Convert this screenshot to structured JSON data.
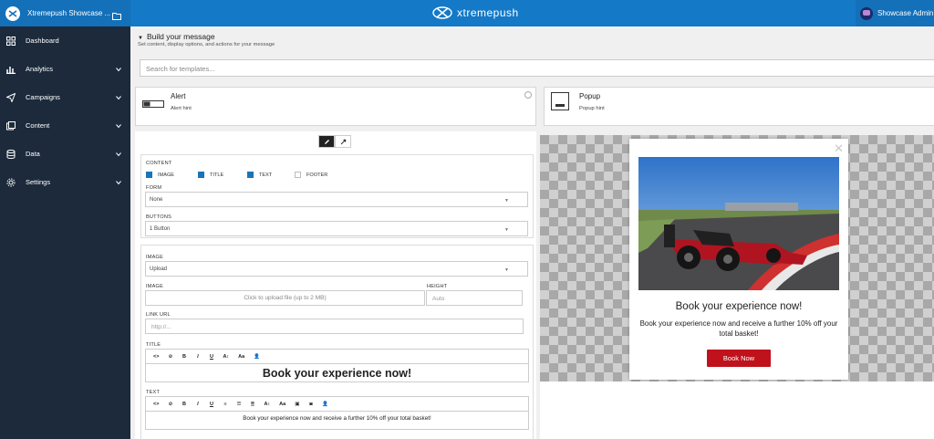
{
  "topbar": {
    "app_title": "Xtremepush Showcase ...",
    "brand": "xtremepush",
    "user_name": "Showcase Admin",
    "colors": {
      "bar": "#1479c7",
      "sidebar": "#1c2a3c",
      "accent_red": "#c0121c",
      "check_blue": "#1a74b8"
    }
  },
  "sidebar": {
    "items": [
      {
        "label": "Dashboard",
        "icon": "dashboard-icon"
      },
      {
        "label": "Analytics",
        "icon": "bar-chart-icon"
      },
      {
        "label": "Campaigns",
        "icon": "paper-plane-icon"
      },
      {
        "label": "Content",
        "icon": "content-icon"
      },
      {
        "label": "Data",
        "icon": "database-icon"
      },
      {
        "label": "Settings",
        "icon": "gear-icon"
      }
    ]
  },
  "build": {
    "title": "Build your message",
    "subtitle": "Set content, display options, and actions for your message"
  },
  "search": {
    "placeholder": "Search for templates..."
  },
  "templates": [
    {
      "name": "Alert",
      "hint": "Alert hint"
    },
    {
      "name": "Popup",
      "hint": "Popup hint"
    }
  ],
  "content": {
    "label": "CONTENT",
    "checks": [
      {
        "label": "IMAGE",
        "checked": true
      },
      {
        "label": "TITLE",
        "checked": true
      },
      {
        "label": "TEXT",
        "checked": true
      },
      {
        "label": "FOOTER",
        "checked": false
      }
    ],
    "form_label": "FORM",
    "form_value": "None",
    "buttons_label": "BUTTONS",
    "buttons_value": "1 Button"
  },
  "image_panel": {
    "image_label": "IMAGE",
    "image_mode": "Upload",
    "image_upload_label": "IMAGE",
    "upload_text": "Click to upload file (up to 2 MB)",
    "height_label": "HEIGHT",
    "height_placeholder": "Auto",
    "link_label": "LINK URL",
    "link_placeholder": "http://...",
    "title_label": "TITLE",
    "title_value": "Book your experience now!",
    "text_label": "TEXT",
    "text_value": "Book your experience now and receive a further 10% off your total basket!"
  },
  "preview": {
    "title": "Book your experience now!",
    "text": "Book your experience now and receive a further 10% off your total basket!",
    "button": "Book Now",
    "close": "✕"
  }
}
